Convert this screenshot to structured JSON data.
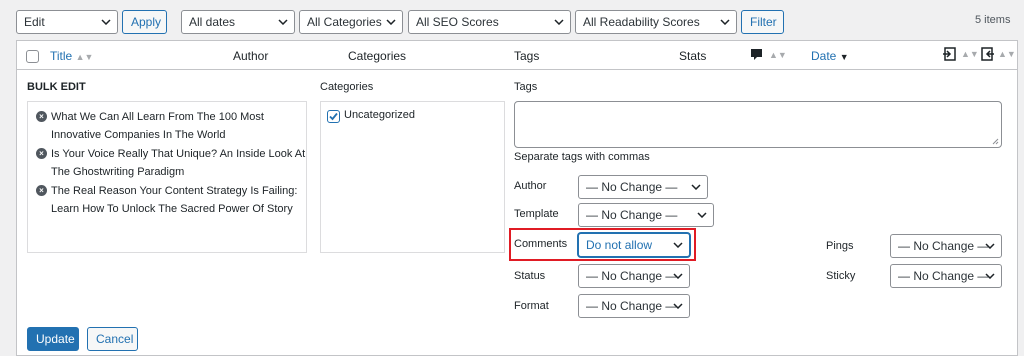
{
  "toolbar": {
    "bulk_action": "Edit",
    "apply_label": "Apply",
    "dates": "All dates",
    "categories": "All Categories",
    "seo": "All SEO Scores",
    "readability": "All Readability Scores",
    "filter_label": "Filter",
    "items_count": "5 items"
  },
  "table": {
    "col_title": "Title",
    "col_author": "Author",
    "col_categories": "Categories",
    "col_tags": "Tags",
    "col_stats": "Stats",
    "col_date": "Date"
  },
  "bulk": {
    "heading": "BULK EDIT",
    "posts": [
      "What We Can All Learn From The 100 Most Innovative Companies In The World",
      "Is Your Voice Really That Unique? An Inside Look At The Ghostwriting Paradigm",
      "The Real Reason Your Content Strategy Is Failing: Learn How To Unlock The Sacred Power Of Story"
    ],
    "categories_label": "Categories",
    "category_item": "Uncategorized",
    "tags_label": "Tags",
    "tags_hint": "Separate tags with commas",
    "author_label": "Author",
    "author_value": "— No Change —",
    "template_label": "Template",
    "template_value": "— No Change —",
    "comments_label": "Comments",
    "comments_value": "Do not allow",
    "status_label": "Status",
    "status_value": "— No Change —",
    "format_label": "Format",
    "format_value": "— No Change —",
    "pings_label": "Pings",
    "pings_value": "— No Change —",
    "sticky_label": "Sticky",
    "sticky_value": "— No Change —",
    "update_label": "Update",
    "cancel_label": "Cancel"
  },
  "colors": {
    "accent": "#2271b1",
    "highlight": "#e01b24"
  }
}
